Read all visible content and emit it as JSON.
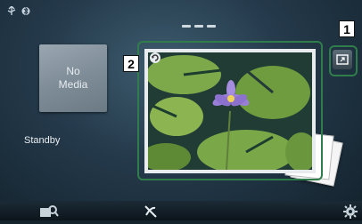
{
  "status_bar": {
    "icons": [
      "usb-icon",
      "bluetooth-icon"
    ]
  },
  "source": {
    "tile_line1": "No",
    "tile_line2": "Media",
    "state": "Standby"
  },
  "callouts": {
    "one": "1",
    "two": "2"
  },
  "bottom_bar": {
    "icons": [
      "source-search-icon",
      "phone-muted-icon",
      "settings-icon"
    ]
  },
  "colors": {
    "highlight": "#2f7d4a",
    "background": "#24394a"
  }
}
